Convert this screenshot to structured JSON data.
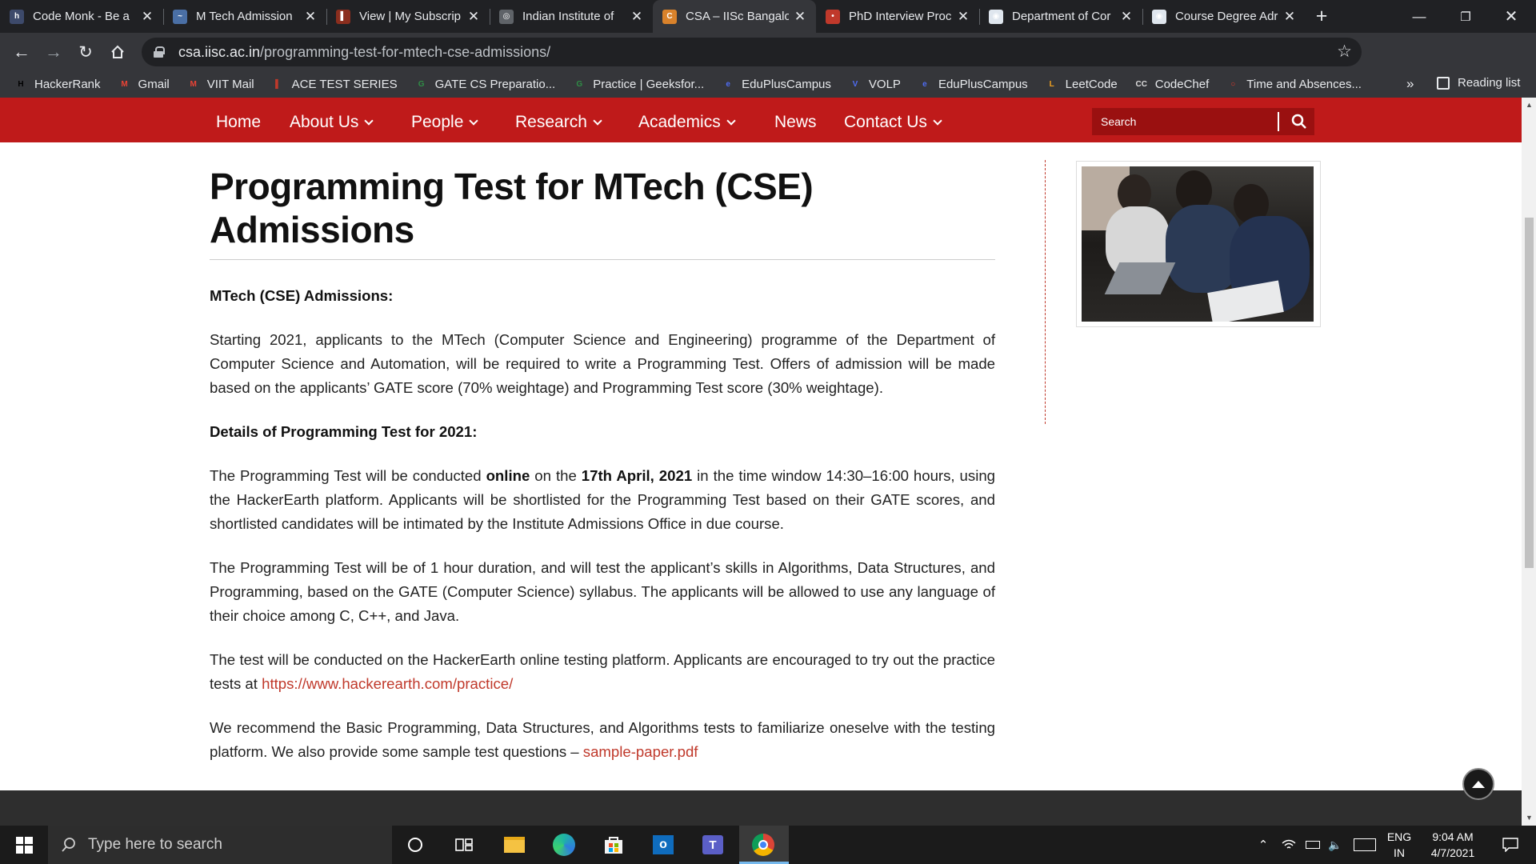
{
  "browser": {
    "tabs": [
      {
        "title": "Code Monk - Be a",
        "favicon_color": "#3d4a6b",
        "favicon_letter": "h"
      },
      {
        "title": "M Tech Admission",
        "favicon_color": "#4a6fa5",
        "favicon_letter": "~"
      },
      {
        "title": "View | My Subscrip",
        "favicon_color": "#8b2e1e",
        "favicon_letter": "▌"
      },
      {
        "title": "Indian Institute of",
        "favicon_color": "#5f6368",
        "favicon_letter": "◎"
      },
      {
        "title": "CSA – IISc Bangalo",
        "favicon_color": "#d9822b",
        "favicon_letter": "C",
        "active": true
      },
      {
        "title": "PhD Interview Proc",
        "favicon_color": "#c0392b",
        "favicon_letter": "•"
      },
      {
        "title": "Department of Cor",
        "favicon_color": "#dfe6ee",
        "favicon_letter": "◉"
      },
      {
        "title": "Course Degree Adr",
        "favicon_color": "#dfe6ee",
        "favicon_letter": "◉"
      }
    ],
    "new_tab": "+",
    "url_host": "csa.iisc.ac.in",
    "url_path": "/programming-test-for-mtech-cse-admissions/",
    "bookmarks": [
      {
        "label": "HackerRank",
        "icon": "hackerrank-icon",
        "color": "#000000",
        "glyph": "H"
      },
      {
        "label": "Gmail",
        "icon": "gmail-icon",
        "color": "#ea4335",
        "glyph": "M"
      },
      {
        "label": "VIIT Mail",
        "icon": "gmail-icon",
        "color": "#ea4335",
        "glyph": "M"
      },
      {
        "label": "ACE TEST SERIES",
        "icon": "ace-icon",
        "color": "#c0392b",
        "glyph": "▌"
      },
      {
        "label": "GATE CS Preparatio...",
        "icon": "gfg-icon",
        "color": "#2f8d46",
        "glyph": "G"
      },
      {
        "label": "Practice | Geeksfor...",
        "icon": "gfg-icon",
        "color": "#2f8d46",
        "glyph": "G"
      },
      {
        "label": "EduPlusCampus",
        "icon": "eduplus-icon",
        "color": "#4f6df5",
        "glyph": "e"
      },
      {
        "label": "VOLP",
        "icon": "volp-icon",
        "color": "#4f6df5",
        "glyph": "V"
      },
      {
        "label": "EduPlusCampus",
        "icon": "eduplus-icon",
        "color": "#4f6df5",
        "glyph": "e"
      },
      {
        "label": "LeetCode",
        "icon": "leetcode-icon",
        "color": "#f0a020",
        "glyph": "L"
      },
      {
        "label": "CodeChef",
        "icon": "codechef-icon",
        "color": "#dddddd",
        "glyph": "CC"
      },
      {
        "label": "Time and Absences...",
        "icon": "oracle-icon",
        "color": "#e8392b",
        "glyph": "○"
      }
    ],
    "bookmarks_more": "»",
    "reading_list": "Reading list"
  },
  "site": {
    "nav": [
      {
        "label": "Home",
        "dropdown": false
      },
      {
        "label": "About Us",
        "dropdown": true
      },
      {
        "label": "People",
        "dropdown": true
      },
      {
        "label": "Research",
        "dropdown": true
      },
      {
        "label": "Academics",
        "dropdown": true
      },
      {
        "label": "News",
        "dropdown": false
      },
      {
        "label": "Contact Us",
        "dropdown": true
      }
    ],
    "search_placeholder": "Search",
    "accent": "#bf1a1a"
  },
  "page": {
    "title": "Programming Test for MTech (CSE) Admissions",
    "heading1": "MTech (CSE) Admissions:",
    "para1": "Starting 2021, applicants to the MTech (Computer Science and Engineering) programme of the Department of Computer Science and Automation, will be required to write a Programming Test. Offers of admission will be made based on the applicants’ GATE score (70% weightage) and Programming Test score (30% weightage).",
    "heading2": "Details of Programming Test for 2021:",
    "para2": {
      "pre": "The Programming Test will be conducted ",
      "b1": "online",
      "mid": " on the ",
      "b2": "17th April, 2021",
      "post": " in the time window 14:30–16:00 hours, using the HackerEarth platform. Applicants will be shortlisted for the Programming Test based on their GATE scores, and shortlisted candidates will be intimated by the Institute Admissions Office in due course."
    },
    "para3": "The Programming Test will be of 1 hour duration, and will test the applicant’s skills in Algorithms, Data Structures, and Programming, based on the GATE (Computer Science) syllabus. The applicants will be allowed to use any language of their choice among C, C++, and Java.",
    "para4": {
      "pre": "The test will be conducted on the HackerEarth online testing  platform. Applicants are encouraged to try out the practice tests at ",
      "link": "https://www.hackerearth.com/practice/"
    },
    "para5": {
      "pre": "We recommend the Basic Programming, Data Structures, and Algorithms tests to familiarize oneselve with the testing platform. We also provide some sample test questions – ",
      "link": "sample-paper.pdf"
    },
    "link_color": "#c0392b"
  },
  "taskbar": {
    "search_placeholder": "Type here to search",
    "lang_top": "ENG",
    "lang_bottom": "IN",
    "time": "9:04 AM",
    "date": "4/7/2021"
  }
}
